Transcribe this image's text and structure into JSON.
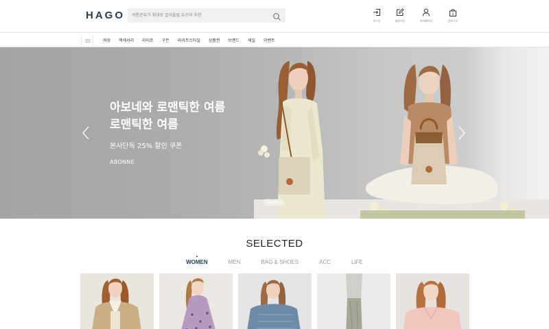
{
  "header": {
    "logo": "HAGO",
    "search_placeholder": "여름분위기 최대로 끌어올릴 슈즈와 추천",
    "utilities": [
      {
        "icon": "login-icon",
        "label": "로그인"
      },
      {
        "icon": "edit-icon",
        "label": "회원가입"
      },
      {
        "icon": "user-icon",
        "label": "마이페이지"
      },
      {
        "icon": "bag-icon",
        "label": "장바구니"
      }
    ]
  },
  "nav": {
    "items": [
      "여성",
      "액세서리",
      "라이프",
      "구든",
      "라이프스타일",
      "상품권",
      "브랜드",
      "세일",
      "이벤트"
    ]
  },
  "hero": {
    "title_line1": "아보네와 로맨틱한 여름",
    "title_line2": "로맨틱한 여름",
    "subtitle": "본사단독 25% 할인 쿠폰",
    "brand": "ABONNE"
  },
  "selected": {
    "title": "SELECTED",
    "tabs": [
      "WOMEN",
      "MEN",
      "BAG & SHOES",
      "ACC",
      "LIFE"
    ],
    "active_tab": "WOMEN"
  },
  "colors": {
    "logo": "#2a3a4c",
    "active_tab": "#1f3b57",
    "hero_text": "#ffffff"
  }
}
